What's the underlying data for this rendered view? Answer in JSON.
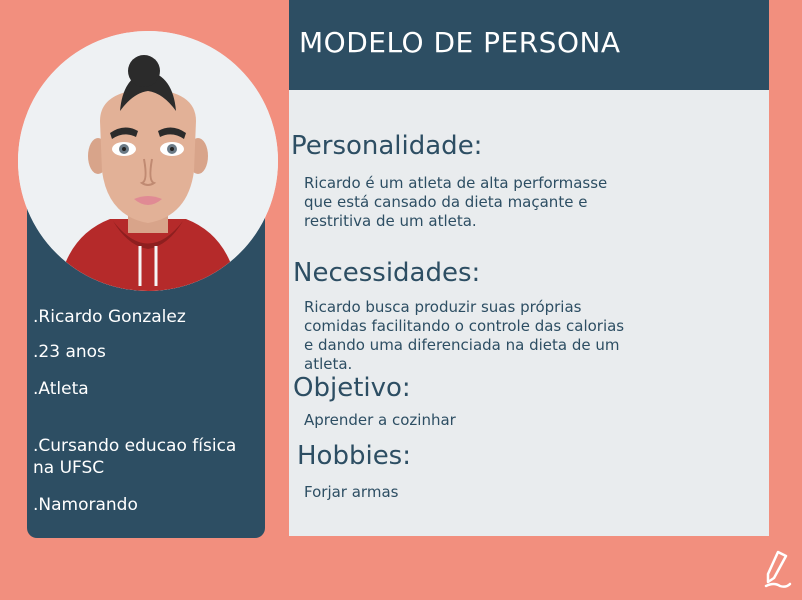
{
  "title": "MODELO DE PERSONA",
  "profile": {
    "name": ".Ricardo Gonzalez",
    "age": ".23 anos",
    "occupation": ".Atleta",
    "education": ".Cursando educao física na UFSC",
    "relationship": ".Namorando"
  },
  "sections": {
    "personalidade": {
      "heading": "Personalidade:",
      "text": "Ricardo é um atleta de alta performasse que está cansado da dieta maçante e restritiva de um atleta."
    },
    "necessidades": {
      "heading": "Necessidades:",
      "text": "Ricardo busca produzir suas próprias comidas facilitando o controle das calorias e dando uma diferenciada na dieta de um atleta."
    },
    "objetivo": {
      "heading": "Objetivo:",
      "text": "Aprender a cozinhar"
    },
    "hobbies": {
      "heading": "Hobbies:",
      "text": "Forjar armas"
    }
  },
  "colors": {
    "background": "#f28f7e",
    "navy": "#2d4e63",
    "panel": "#e9ecee"
  },
  "icons": {
    "avatar": "person-avatar-icon",
    "corner": "pen-icon"
  }
}
